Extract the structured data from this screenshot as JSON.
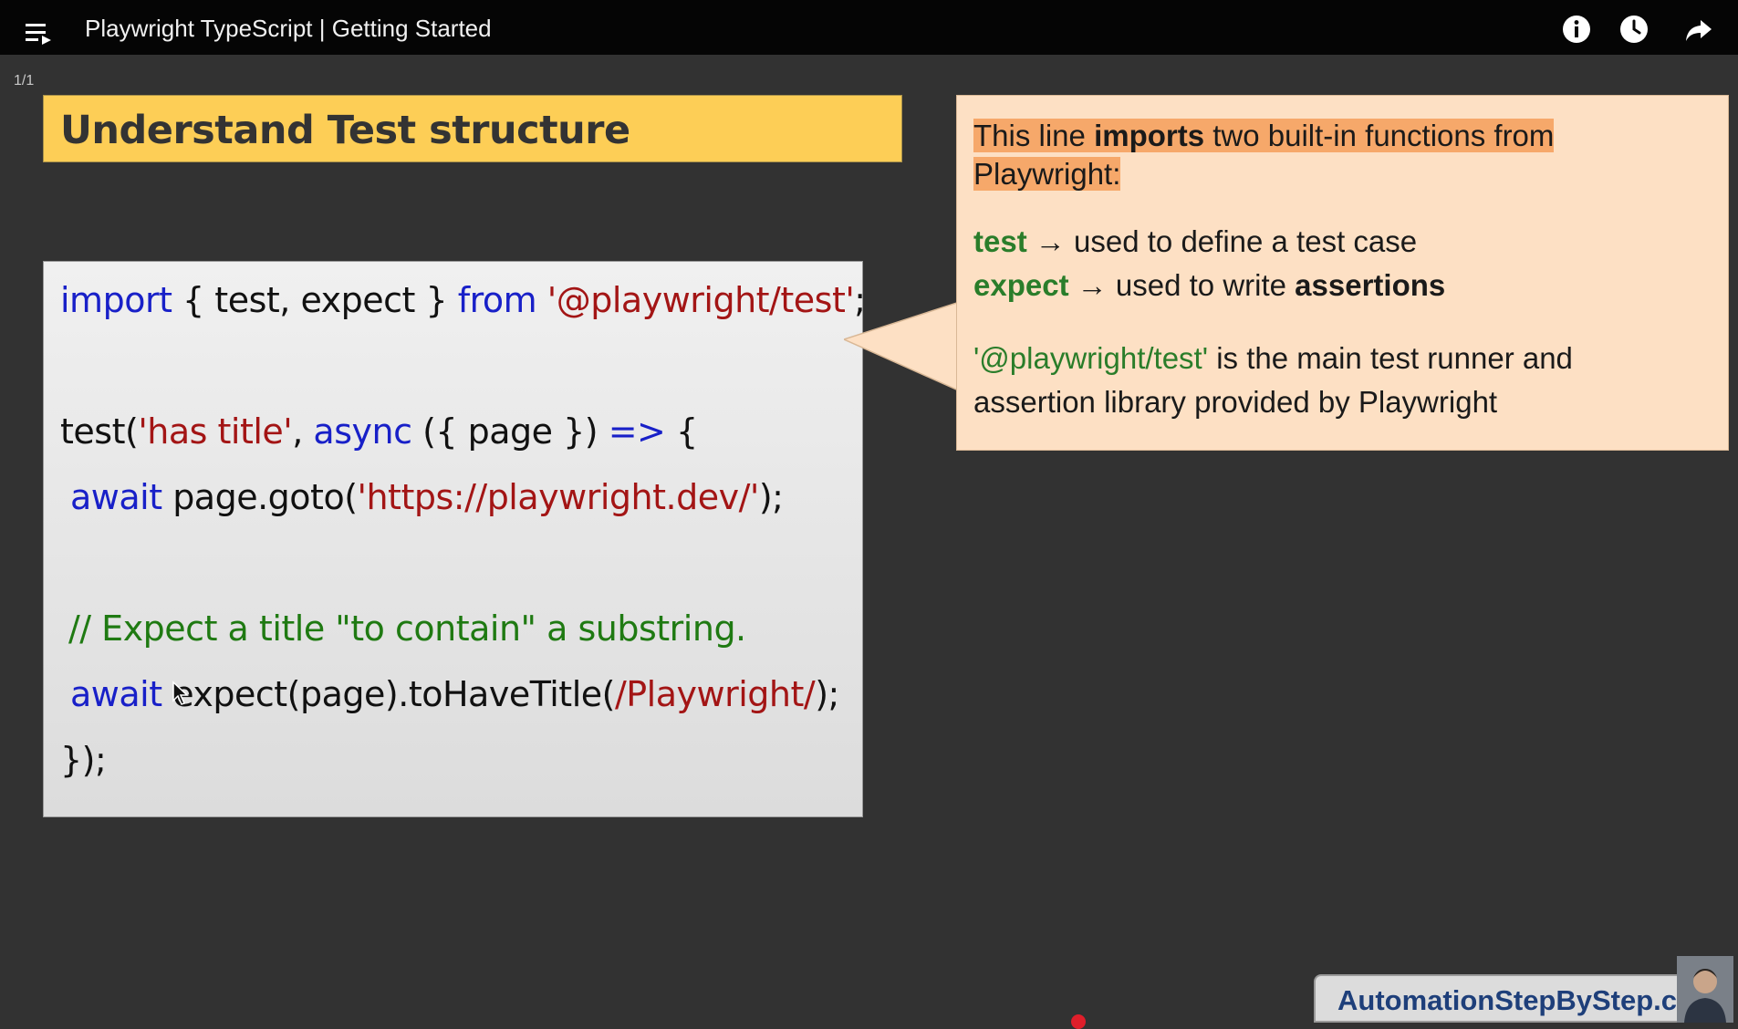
{
  "header": {
    "title": "Playwright TypeScript | Getting Started",
    "icons": [
      "playlist-icon",
      "info-icon",
      "watch-later-icon",
      "share-icon"
    ]
  },
  "slide": {
    "counter": "1/1",
    "heading": "Understand Test structure"
  },
  "code": {
    "line1": {
      "import_kw": "import",
      "names": " { test, expect } ",
      "from_kw": "from",
      "space": " ",
      "module": "'@playwright/test'",
      "semi": ";"
    },
    "line2": {
      "fn": "test(",
      "title": "'has title'",
      "comma": ", ",
      "async_kw": "async",
      "params": " ({ page }) ",
      "arrow": "=>",
      "brace": " {"
    },
    "line3": {
      "await_kw": "await",
      "call": " page.goto(",
      "url": "'https://playwright.dev/'",
      "end": ");"
    },
    "line4": {
      "comment": "// Expect a title \"to contain\" a substring."
    },
    "line5": {
      "await_kw": "await",
      "call": " expect(page).toHaveTitle(",
      "regex": "/Playwright/",
      "end": ");"
    },
    "line6": {
      "close": "});"
    }
  },
  "callout": {
    "p1_pre": "This line ",
    "p1_bold": "imports",
    "p1_post": " two built-in functions from",
    "p1_line2": "Playwright:",
    "test_term": "test",
    "test_desc": " → used to define a test case",
    "expect_term": "expect",
    "expect_desc": " → used to write ",
    "expect_bold": "assertions",
    "module_name": "'@playwright/test'",
    "module_desc": " is the main test runner and",
    "module_desc2": "assertion library provided by Playwright"
  },
  "watermark": {
    "text": "AutomationStepByStep.com"
  },
  "colors": {
    "keyword": "#1820c8",
    "string": "#a31515",
    "comment": "#1f7a12",
    "heading_bg": "#fdce56",
    "callout_bg": "#fde0c4",
    "highlight": "#f6a86a",
    "term_green": "#2a7d2a",
    "progress": "#e01e2a"
  }
}
